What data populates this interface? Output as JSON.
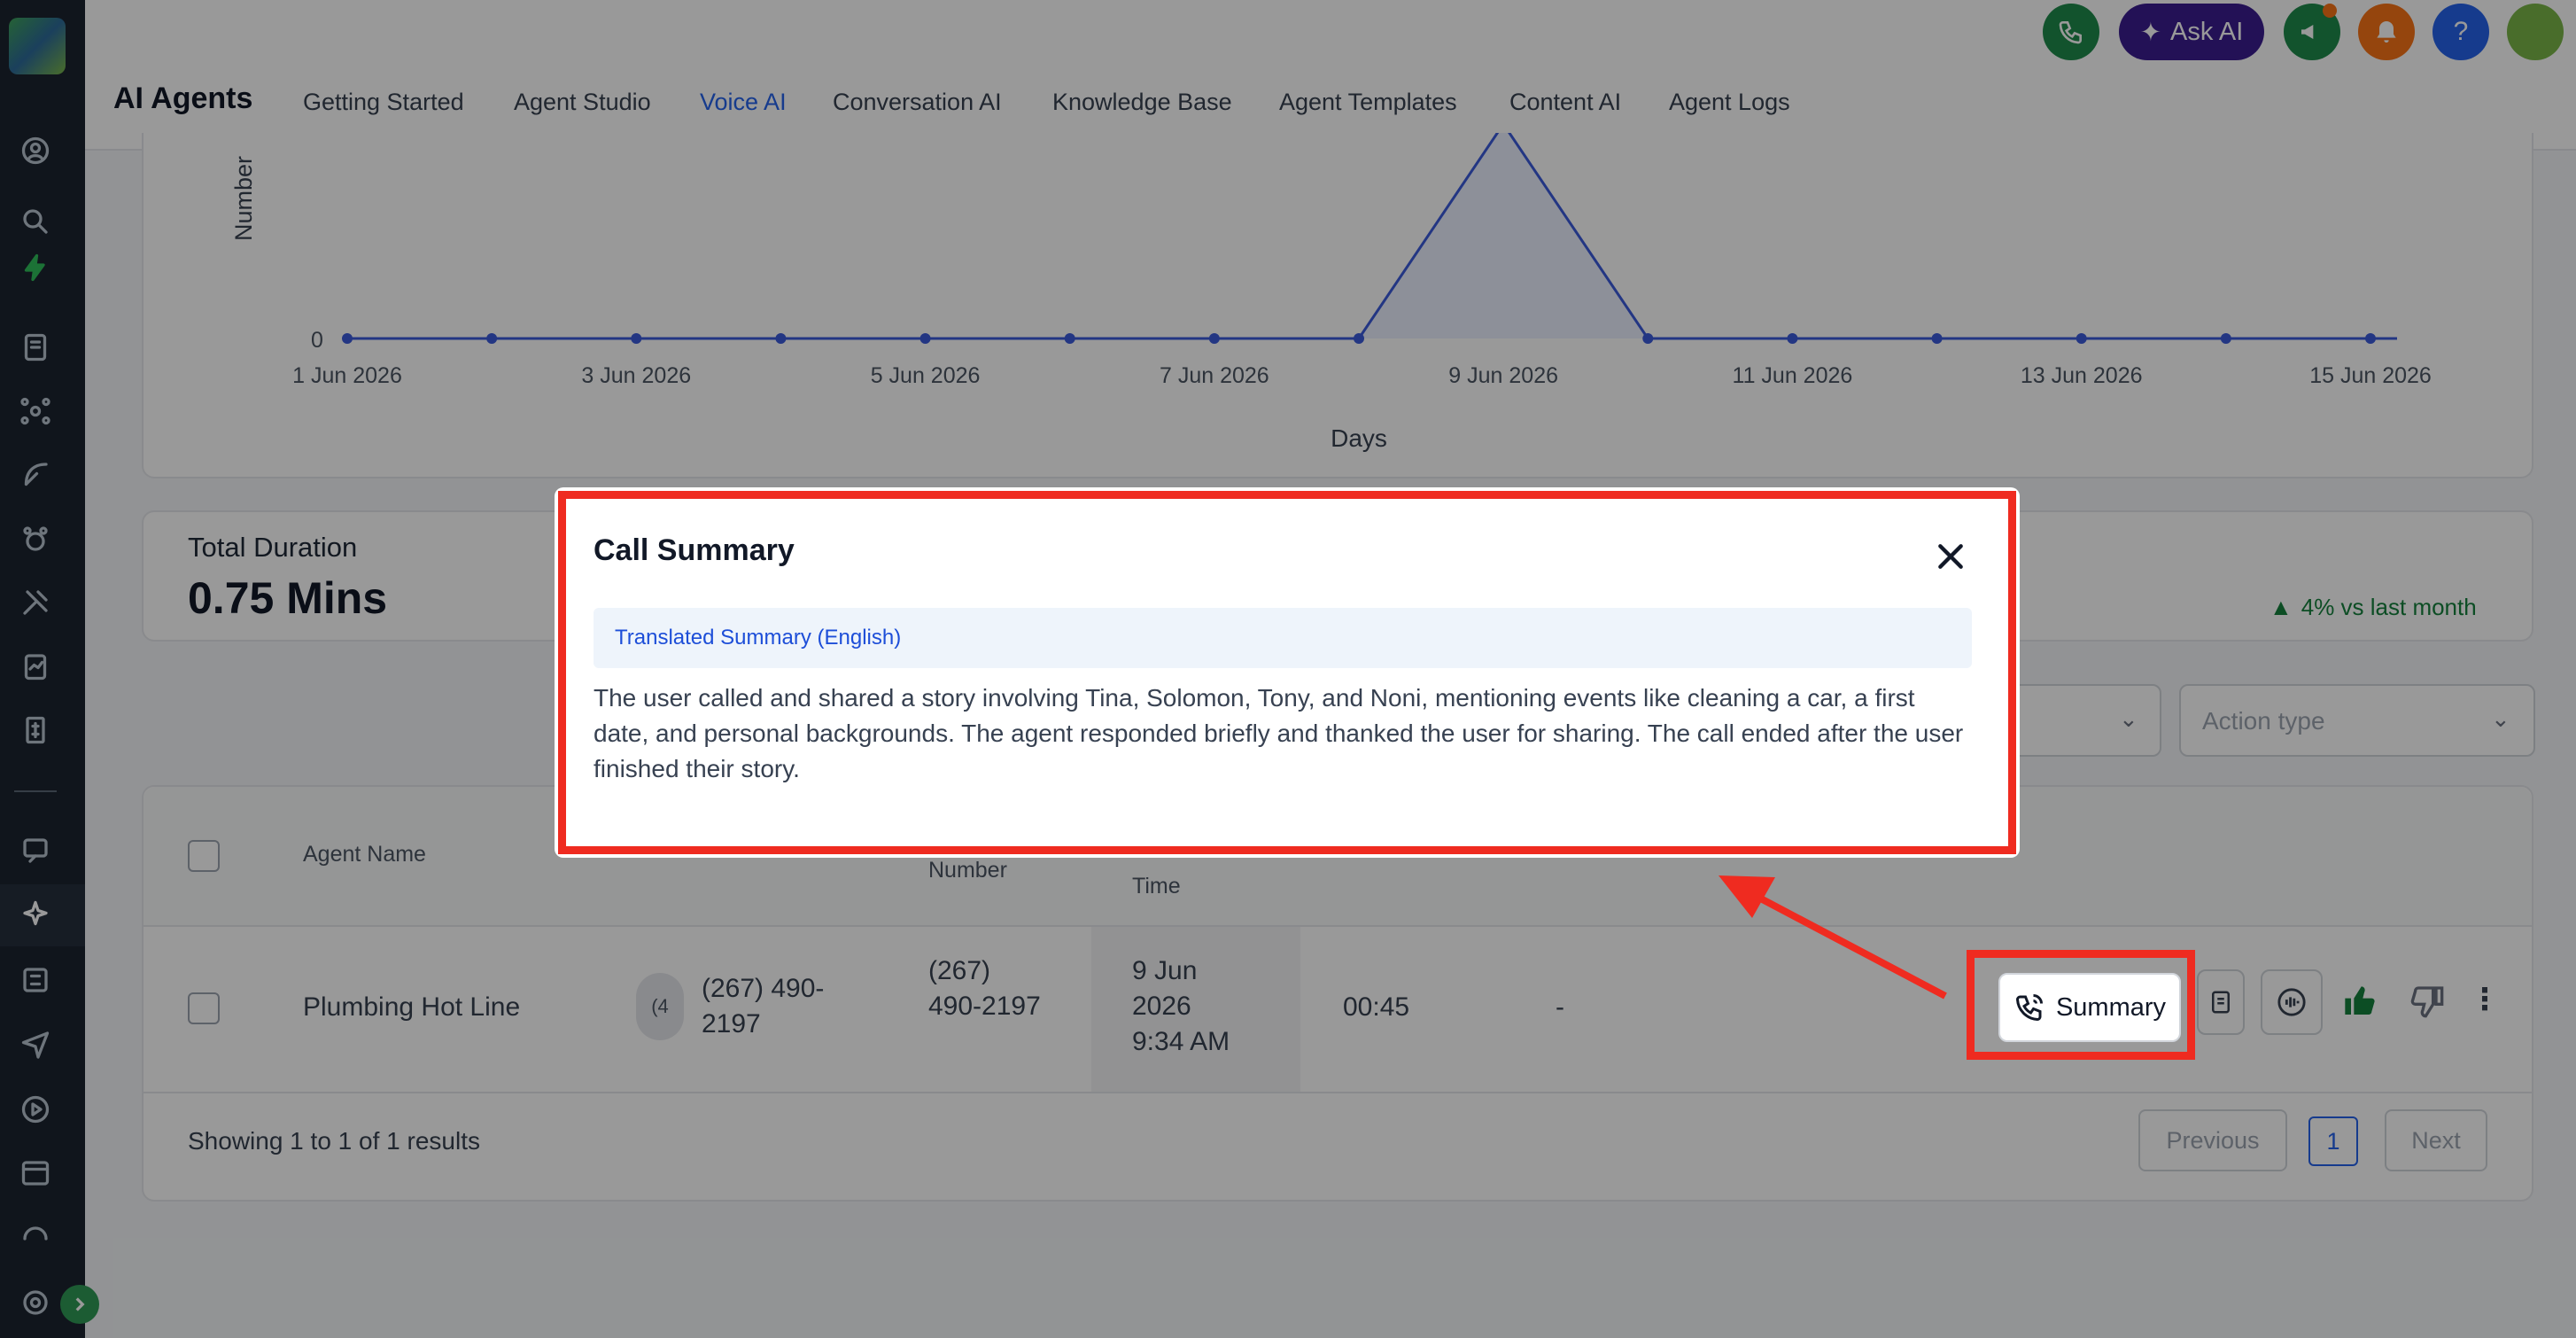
{
  "header": {
    "app_title": "AI Agents",
    "tabs": [
      {
        "label": "Getting Started"
      },
      {
        "label": "Agent Studio"
      },
      {
        "label": "Voice AI"
      },
      {
        "label": "Conversation AI"
      },
      {
        "label": "Knowledge Base"
      },
      {
        "label": "Agent Templates"
      },
      {
        "label": "Content AI"
      },
      {
        "label": "Agent Logs"
      }
    ],
    "ask_ai_label": "Ask AI",
    "help_label": "?"
  },
  "chart": {
    "y_label": "Number",
    "x_label": "Days",
    "x_ticks": [
      "1 Jun 2026",
      "3 Jun 2026",
      "5 Jun 2026",
      "7 Jun 2026",
      "9 Jun 2026",
      "11 Jun 2026",
      "13 Jun 2026",
      "15 Jun 2026"
    ],
    "y_tick": "0"
  },
  "chart_data": {
    "type": "line",
    "title": "",
    "xlabel": "Days",
    "ylabel": "Number",
    "x": [
      "1 Jun 2026",
      "2 Jun 2026",
      "3 Jun 2026",
      "4 Jun 2026",
      "5 Jun 2026",
      "6 Jun 2026",
      "7 Jun 2026",
      "8 Jun 2026",
      "9 Jun 2026",
      "10 Jun 2026",
      "11 Jun 2026",
      "12 Jun 2026",
      "13 Jun 2026",
      "14 Jun 2026",
      "15 Jun 2026"
    ],
    "series": [
      {
        "values": [
          0,
          0,
          0,
          0,
          0,
          0,
          0,
          0,
          1,
          0,
          0,
          0,
          0,
          0,
          0
        ]
      }
    ]
  },
  "stats": {
    "total_duration_label": "Total Duration",
    "total_duration_value": "0.75 Mins",
    "trend": "4% vs last month"
  },
  "filters": {
    "action_type_placeholder": "Action type"
  },
  "table": {
    "headers": [
      "Agent Name",
      "Number",
      "Time"
    ],
    "row": {
      "agent_name": "Plumbing Hot Line",
      "avatar_text": "(4",
      "contact": "(267) 490-2197",
      "number": "(267) 490-2197",
      "date": "9 Jun 2026",
      "time": "9:34 AM",
      "duration": "00:45",
      "actions": "-",
      "summary_button": "Summary"
    },
    "footer_text": "Showing 1 to 1 of 1 results",
    "pagination": {
      "previous": "Previous",
      "page": "1",
      "next": "Next"
    }
  },
  "modal": {
    "title": "Call Summary",
    "tag": "Translated Summary (English)",
    "body": "The user called and shared a story involving Tina, Solomon, Tony, and Noni, mentioning events like cleaning a car, a first date, and personal backgrounds. The agent responded briefly and thanked the user for sharing. The call ended after the user finished their story."
  },
  "colors": {
    "accent": "#2563eb",
    "highlight": "#ef2b20",
    "sidebar": "#1b2430"
  }
}
